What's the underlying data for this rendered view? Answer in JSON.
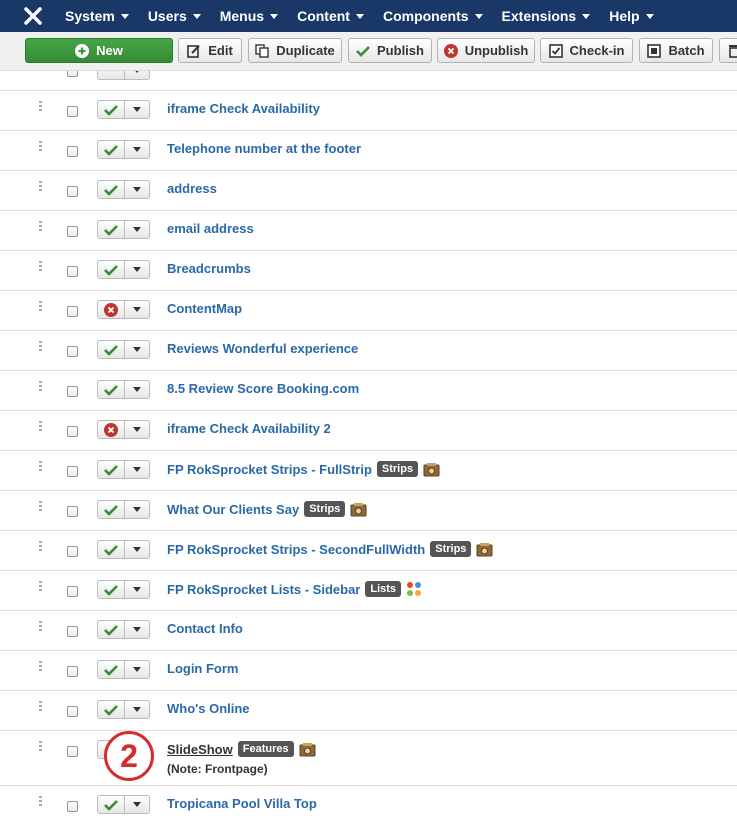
{
  "menubar": {
    "items": [
      "System",
      "Users",
      "Menus",
      "Content",
      "Components",
      "Extensions",
      "Help"
    ]
  },
  "toolbar": {
    "new_label": "New",
    "edit_label": "Edit",
    "duplicate_label": "Duplicate",
    "publish_label": "Publish",
    "unpublish_label": "Unpublish",
    "checkin_label": "Check-in",
    "batch_label": "Batch"
  },
  "colors": {
    "topbar": "#1a3867",
    "link": "#2a69a8",
    "published": "#3c8b3c",
    "unpublished": "#bd362f",
    "badge": "#555555",
    "annotation": "#d52b2b"
  },
  "modules": [
    {
      "title": "iframe Check Availability",
      "published": true
    },
    {
      "title": "Telephone number at the footer",
      "published": true
    },
    {
      "title": "address",
      "published": true
    },
    {
      "title": "email address",
      "published": true
    },
    {
      "title": "Breadcrumbs",
      "published": true
    },
    {
      "title": "ContentMap",
      "published": false
    },
    {
      "title": "Reviews Wonderful experience",
      "published": true
    },
    {
      "title": "8.5 Review Score Booking.com",
      "published": true
    },
    {
      "title": "iframe Check Availability 2",
      "published": false
    },
    {
      "title": "FP RokSprocket Strips - FullStrip",
      "published": true,
      "badge": "Strips",
      "icon": "rocket-icon"
    },
    {
      "title": "What Our Clients Say",
      "published": true,
      "badge": "Strips",
      "icon": "rocket-icon"
    },
    {
      "title": "FP RokSprocket Strips - SecondFullWidth",
      "published": true,
      "badge": "Strips",
      "icon": "rocket-icon"
    },
    {
      "title": "FP RokSprocket Lists - Sidebar",
      "published": true,
      "badge": "Lists",
      "icon": "joomla-icon"
    },
    {
      "title": "Contact Info",
      "published": true
    },
    {
      "title": "Login Form",
      "published": true
    },
    {
      "title": "Who's Online",
      "published": true
    },
    {
      "title": "SlideShow",
      "published": true,
      "badge": "Features",
      "icon": "rocket-icon",
      "note": "(Note: Frontpage)"
    },
    {
      "title": "Tropicana Pool Villa Top",
      "published": true
    }
  ],
  "annotation": {
    "label": "2"
  }
}
